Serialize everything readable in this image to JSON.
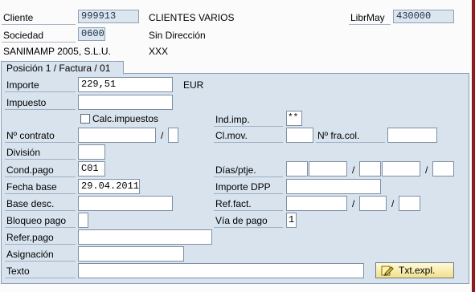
{
  "header": {
    "cliente_label": "Cliente",
    "cliente_value": "999913",
    "cliente_name": "CLIENTES VARIOS",
    "librmay_label": "LibrMay",
    "librmay_value": "430000",
    "sociedad_label": "Sociedad",
    "sociedad_value": "0600",
    "direccion": "Sin Dirección",
    "company_name": "SANIMAMP 2005, S.L.U.",
    "city": "XXX"
  },
  "panel": {
    "tab_label": "Posición 1 / Factura / 01",
    "importe_label": "Importe",
    "importe_value": "229,51",
    "currency": "EUR",
    "impuesto_label": "Impuesto",
    "impuesto_value": "",
    "calc_impuestos_label": "Calc.impuestos",
    "ind_imp_label": "Ind.imp.",
    "ind_imp_value": "**",
    "nro_contrato_label": "Nº contrato",
    "slash": "/",
    "cl_mov_label": "Cl.mov.",
    "nro_fra_col_label": "Nº fra.col.",
    "division_label": "División",
    "cond_pago_label": "Cond.pago",
    "cond_pago_value": "C01",
    "dias_ptje_label": "Días/ptje.",
    "fecha_base_label": "Fecha base",
    "fecha_base_value": "29.04.2011",
    "importe_dpp_label": "Importe DPP",
    "base_desc_label": "Base desc.",
    "ref_fact_label": "Ref.fact.",
    "bloqueo_pago_label": "Bloqueo pago",
    "via_pago_label": "Vía de pago",
    "via_pago_value": "1",
    "refer_pago_label": "Refer.pago",
    "asignacion_label": "Asignación",
    "texto_label": "Texto",
    "txt_expl_label": "Txt.expl."
  },
  "colors": {
    "panel_bg": "#d8e3ee",
    "readonly_bg": "#dce6ef",
    "button_bg": "#f1e08c",
    "accent_border": "#8f1c1c"
  }
}
